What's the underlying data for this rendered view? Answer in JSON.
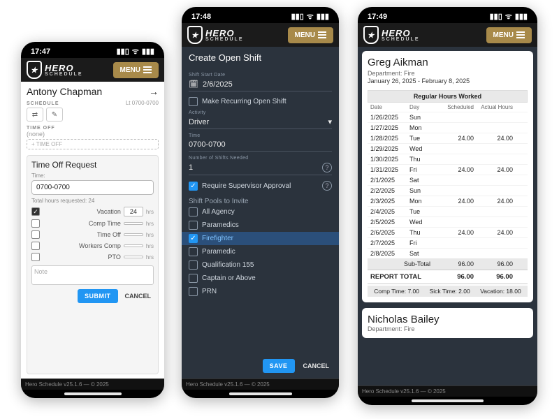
{
  "brand": {
    "name": "HERO",
    "sub": "SCHEDULE"
  },
  "menu_label": "MENU",
  "footer": "Hero Schedule v25.1.6 — © 2025",
  "phone1": {
    "time": "17:47",
    "employee": "Antony Chapman",
    "schedule_label": "SCHEDULE",
    "schedule_value": "Lt 0700-0700",
    "timeoff_label": "TIME OFF",
    "timeoff_none": "(none)",
    "timeoff_button": "+  TIME OFF",
    "request_title": "Time Off Request",
    "time_field_label": "Time:",
    "time_field_value": "0700-0700",
    "total_hours": "Total hours requested: 24",
    "types": [
      {
        "label": "Vacation",
        "hours": "24",
        "checked": true
      },
      {
        "label": "Comp Time",
        "hours": "",
        "checked": false
      },
      {
        "label": "Time Off",
        "hours": "",
        "checked": false
      },
      {
        "label": "Workers Comp",
        "hours": "",
        "checked": false
      },
      {
        "label": "PTO",
        "hours": "",
        "checked": false
      }
    ],
    "hrs_suffix": "hrs",
    "note_placeholder": "Note",
    "submit": "SUBMIT",
    "cancel": "CANCEL"
  },
  "phone2": {
    "time": "17:48",
    "title": "Create Open Shift",
    "start_date_label": "Shift Start Date",
    "start_date": "2/6/2025",
    "recurring_label": "Make Recurring Open Shift",
    "activity_label": "Activity",
    "activity": "Driver",
    "time_label": "Time",
    "time_value": "0700-0700",
    "num_label": "Number of Shifts Needed",
    "num_value": "1",
    "require_supervisor": "Require Supervisor Approval",
    "pools_title": "Shift Pools to Invite",
    "pools": [
      {
        "label": "All Agency",
        "checked": false,
        "selected": false
      },
      {
        "label": "Paramedics",
        "checked": false,
        "selected": false
      },
      {
        "label": "Firefighter",
        "checked": true,
        "selected": true
      },
      {
        "label": "Paramedic",
        "checked": false,
        "selected": false
      },
      {
        "label": "Qualification 155",
        "checked": false,
        "selected": false
      },
      {
        "label": "Captain or Above",
        "checked": false,
        "selected": false
      },
      {
        "label": "PRN",
        "checked": false,
        "selected": false
      }
    ],
    "save": "SAVE",
    "cancel": "CANCEL"
  },
  "phone3": {
    "time": "17:49",
    "name": "Greg Aikman",
    "dept_label": "Department:",
    "dept": "Fire",
    "range": "January 26, 2025 - February 8, 2025",
    "table_title": "Regular Hours Worked",
    "cols": {
      "date": "Date",
      "day": "Day",
      "scheduled": "Scheduled",
      "actual": "Actual Hours"
    },
    "rows": [
      {
        "date": "1/26/2025",
        "day": "Sun",
        "sched": "",
        "actual": ""
      },
      {
        "date": "1/27/2025",
        "day": "Mon",
        "sched": "",
        "actual": ""
      },
      {
        "date": "1/28/2025",
        "day": "Tue",
        "sched": "24.00",
        "actual": "24.00"
      },
      {
        "date": "1/29/2025",
        "day": "Wed",
        "sched": "",
        "actual": ""
      },
      {
        "date": "1/30/2025",
        "day": "Thu",
        "sched": "",
        "actual": ""
      },
      {
        "date": "1/31/2025",
        "day": "Fri",
        "sched": "24.00",
        "actual": "24.00"
      },
      {
        "date": "2/1/2025",
        "day": "Sat",
        "sched": "",
        "actual": ""
      },
      {
        "date": "2/2/2025",
        "day": "Sun",
        "sched": "",
        "actual": ""
      },
      {
        "date": "2/3/2025",
        "day": "Mon",
        "sched": "24.00",
        "actual": "24.00"
      },
      {
        "date": "2/4/2025",
        "day": "Tue",
        "sched": "",
        "actual": ""
      },
      {
        "date": "2/5/2025",
        "day": "Wed",
        "sched": "",
        "actual": ""
      },
      {
        "date": "2/6/2025",
        "day": "Thu",
        "sched": "24.00",
        "actual": "24.00"
      },
      {
        "date": "2/7/2025",
        "day": "Fri",
        "sched": "",
        "actual": ""
      },
      {
        "date": "2/8/2025",
        "day": "Sat",
        "sched": "",
        "actual": ""
      }
    ],
    "subtotal_label": "Sub-Total",
    "subtotal_sched": "96.00",
    "subtotal_actual": "96.00",
    "reporttotal_label": "REPORT TOTAL",
    "reporttotal_sched": "96.00",
    "reporttotal_actual": "96.00",
    "comp": "Comp Time: 7.00",
    "sick": "Sick Time: 2.00",
    "vac": "Vacation: 18.00",
    "second_name": "Nicholas Bailey",
    "second_dept": "Fire"
  }
}
